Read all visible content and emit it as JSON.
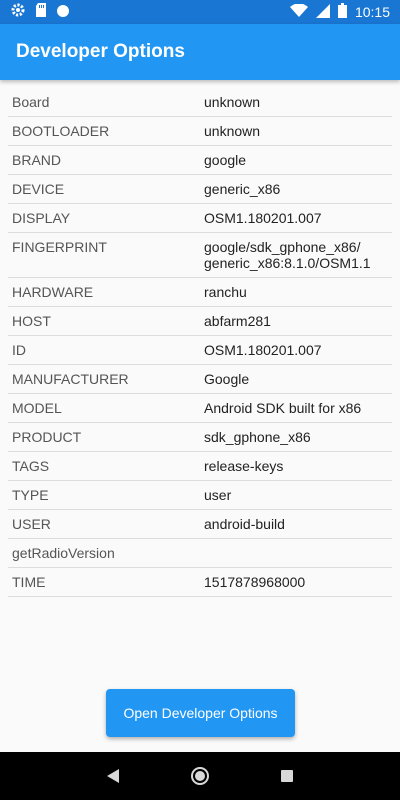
{
  "status_bar": {
    "time": "10:15",
    "left_icons": [
      "gear-icon",
      "sd-card-icon",
      "circle-icon"
    ],
    "right_icons": [
      "wifi-icon",
      "signal-icon",
      "battery-icon"
    ]
  },
  "app_bar": {
    "title": "Developer Options"
  },
  "info_rows": [
    {
      "key": "Board",
      "value": "unknown"
    },
    {
      "key": "BOOTLOADER",
      "value": "unknown"
    },
    {
      "key": "BRAND",
      "value": "google"
    },
    {
      "key": "DEVICE",
      "value": "generic_x86"
    },
    {
      "key": "DISPLAY",
      "value": "OSM1.180201.007"
    },
    {
      "key": "FINGERPRINT",
      "value": "google/sdk_gphone_x86/\ngeneric_x86:8.1.0/OSM1.1"
    },
    {
      "key": "HARDWARE",
      "value": "ranchu"
    },
    {
      "key": "HOST",
      "value": "abfarm281"
    },
    {
      "key": "ID",
      "value": "OSM1.180201.007"
    },
    {
      "key": "MANUFACTURER",
      "value": "Google"
    },
    {
      "key": "MODEL",
      "value": "Android SDK built for x86"
    },
    {
      "key": "PRODUCT",
      "value": "sdk_gphone_x86"
    },
    {
      "key": "TAGS",
      "value": "release-keys"
    },
    {
      "key": "TYPE",
      "value": "user"
    },
    {
      "key": "USER",
      "value": "android-build"
    },
    {
      "key": "getRadioVersion",
      "value": ""
    },
    {
      "key": "TIME",
      "value": "1517878968000"
    }
  ],
  "button": {
    "label": "Open Developer Options"
  },
  "nav_bar": {
    "icons": [
      "back-icon",
      "home-icon",
      "recents-icon"
    ]
  },
  "colors": {
    "primary": "#2196f3",
    "primary_dark": "#1976d2"
  }
}
